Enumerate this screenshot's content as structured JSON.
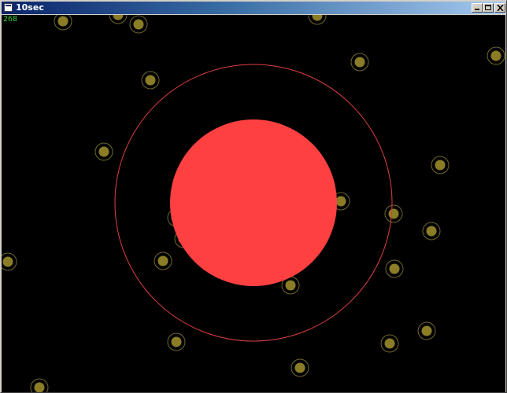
{
  "window": {
    "title": "10sec",
    "buttons": {
      "minimize": "minimize",
      "maximize": "maximize",
      "close": "close"
    }
  },
  "game": {
    "score": "268",
    "colors": {
      "background": "#000000",
      "player_fill": "#ff4040",
      "player_ring": "#e04040",
      "dot_fill": "#8a7d26",
      "dot_ring": "#6f6630",
      "score_text": "#33cc33"
    },
    "dot_count": 27
  }
}
